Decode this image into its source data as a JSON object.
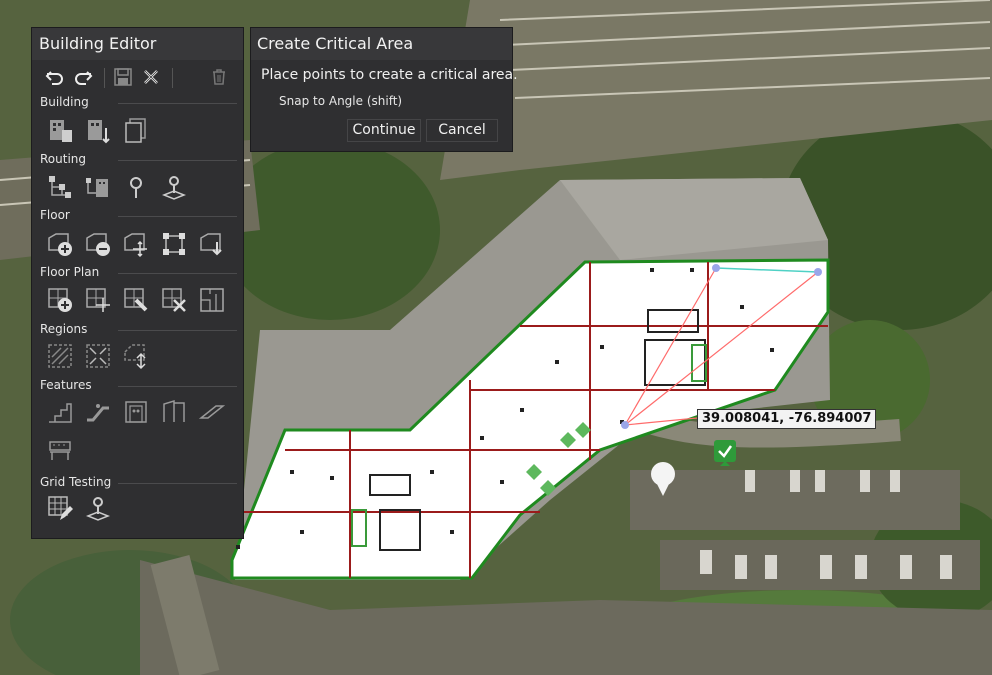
{
  "building_editor": {
    "title": "Building Editor",
    "toolbar": {
      "undo_icon": "undo-icon",
      "redo_icon": "redo-icon",
      "save_icon": "save-icon",
      "discard_icon": "discard-icon",
      "delete_icon": "trash-icon"
    },
    "sections": [
      {
        "label": "Building",
        "tools": [
          "building-add-icon",
          "building-move-icon",
          "building-copy-icon"
        ]
      },
      {
        "label": "Routing",
        "tools": [
          "route-network-icon",
          "route-building-icon",
          "route-point-icon",
          "route-node-icon"
        ]
      },
      {
        "label": "Floor",
        "tools": [
          "floor-add-icon",
          "floor-remove-icon",
          "floor-move-icon",
          "floor-vertices-icon",
          "floor-export-icon"
        ]
      },
      {
        "label": "Floor Plan",
        "tools": [
          "floorplan-add-icon",
          "floorplan-move-icon",
          "floorplan-edit-icon",
          "floorplan-delete-icon",
          "floorplan-layout-icon"
        ]
      },
      {
        "label": "Regions",
        "tools": [
          "region-draw-icon",
          "region-shrink-icon",
          "region-move-icon"
        ]
      },
      {
        "label": "Features",
        "tools": [
          "stairs-icon",
          "escalator-icon",
          "elevator-icon",
          "door-icon",
          "ramp-icon",
          "bench-icon"
        ]
      },
      {
        "label": "Grid Testing",
        "tools": [
          "grid-edit-icon",
          "grid-point-icon"
        ]
      }
    ]
  },
  "critical_area_dialog": {
    "title": "Create Critical Area",
    "message": "Place points to create a critical area.",
    "snap_hint": "Snap to Angle (shift)",
    "continue_label": "Continue",
    "cancel_label": "Cancel"
  },
  "map": {
    "coordinate_readout": "39.008041, -76.894007",
    "marker_icon": "checkmark-pin-icon",
    "location_icon": "location-pin-icon",
    "colors": {
      "floor_outline": "#1f8a1f",
      "grid_lines": "#9b1b1b",
      "critical_area_lines": "#ff6b6b",
      "critical_area_top_edge": "#4fd1c5",
      "vertex": "#9aa6e8"
    }
  }
}
